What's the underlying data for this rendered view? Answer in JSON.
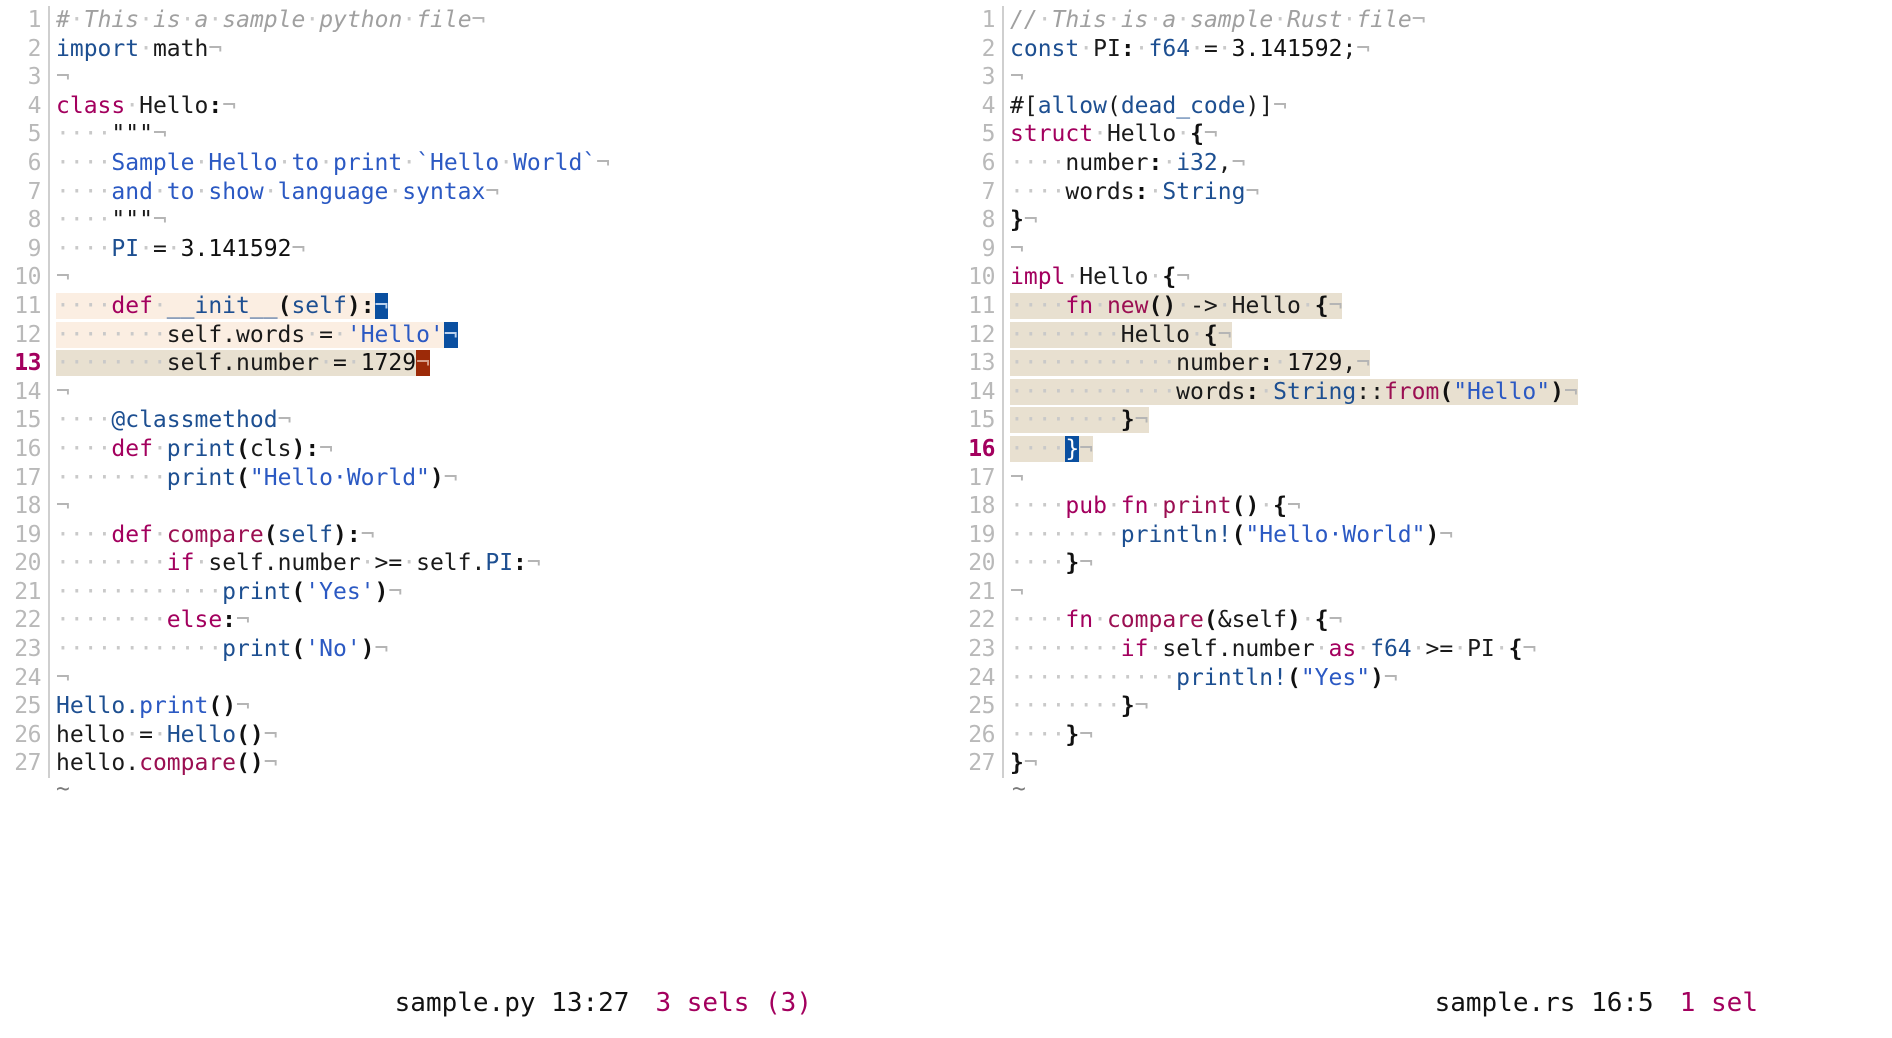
{
  "editor": {
    "kind": "terminal-text-editor",
    "colors": {
      "background": "#ffffff",
      "line_number": "#b9b9b9",
      "line_number_current": "#a3005e",
      "comment": "#a0a0a0",
      "keyword": "#a3005e",
      "function": "#9b0f52",
      "type": "#1d4f91",
      "string": "#2b59c3",
      "selection_secondary": "#fbeee2",
      "selection_primary": "#e8e0d0",
      "cursor_primary": "#0a4fa0",
      "cursor_secondary": "#9c2a08",
      "status_selection": "#a3005e"
    }
  },
  "panes": [
    {
      "id": "left-pane",
      "filename": "sample.py",
      "language": "python",
      "current_line": 13,
      "status": {
        "file_position": "sample.py 13:27",
        "selections": "3 sels (3)"
      },
      "lines": [
        {
          "n": 1,
          "text": "#·This·is·a·sample·python·file¬"
        },
        {
          "n": 2,
          "text": "import·math¬"
        },
        {
          "n": 3,
          "text": "¬"
        },
        {
          "n": 4,
          "text": "class·Hello:¬"
        },
        {
          "n": 5,
          "text": "····\"\"\"¬"
        },
        {
          "n": 6,
          "text": "····Sample·Hello·to·print·`Hello·World`¬"
        },
        {
          "n": 7,
          "text": "····and·to·show·language·syntax¬"
        },
        {
          "n": 8,
          "text": "····\"\"\"¬"
        },
        {
          "n": 9,
          "text": "····PI·=·3.141592¬"
        },
        {
          "n": 10,
          "text": "¬"
        },
        {
          "n": 11,
          "text": "····def·__init__(self):¬",
          "selected": "secondary",
          "cursor": "blue"
        },
        {
          "n": 12,
          "text": "········self.words·=·'Hello'¬",
          "selected": "secondary",
          "cursor": "blue"
        },
        {
          "n": 13,
          "text": "········self.number·=·1729¬",
          "selected": "primary",
          "cursor": "red",
          "current": true
        },
        {
          "n": 14,
          "text": "¬"
        },
        {
          "n": 15,
          "text": "····@classmethod¬"
        },
        {
          "n": 16,
          "text": "····def·print(cls):¬"
        },
        {
          "n": 17,
          "text": "········print(\"Hello·World\")¬"
        },
        {
          "n": 18,
          "text": "¬"
        },
        {
          "n": 19,
          "text": "····def·compare(self):¬"
        },
        {
          "n": 20,
          "text": "········if·self.number·>=·self.PI:¬"
        },
        {
          "n": 21,
          "text": "············print('Yes')¬"
        },
        {
          "n": 22,
          "text": "········else:¬"
        },
        {
          "n": 23,
          "text": "············print('No')¬"
        },
        {
          "n": 24,
          "text": "¬"
        },
        {
          "n": 25,
          "text": "Hello.print()¬"
        },
        {
          "n": 26,
          "text": "hello·=·Hello()¬"
        },
        {
          "n": 27,
          "text": "hello.compare()¬"
        }
      ],
      "eof_marker": "~"
    },
    {
      "id": "right-pane",
      "filename": "sample.rs",
      "language": "rust",
      "current_line": 16,
      "status": {
        "file_position": "sample.rs 16:5",
        "selections": "1 sel"
      },
      "lines": [
        {
          "n": 1,
          "text": "//·This·is·a·sample·Rust·file¬"
        },
        {
          "n": 2,
          "text": "const·PI:·f64·=·3.141592;¬"
        },
        {
          "n": 3,
          "text": "¬"
        },
        {
          "n": 4,
          "text": "#[allow(dead_code)]¬"
        },
        {
          "n": 5,
          "text": "struct·Hello·{¬"
        },
        {
          "n": 6,
          "text": "····number:·i32,¬"
        },
        {
          "n": 7,
          "text": "····words:·String¬"
        },
        {
          "n": 8,
          "text": "}¬"
        },
        {
          "n": 9,
          "text": "¬"
        },
        {
          "n": 10,
          "text": "impl·Hello·{¬"
        },
        {
          "n": 11,
          "text": "····fn·new()·->·Hello·{¬",
          "selected": "primary"
        },
        {
          "n": 12,
          "text": "········Hello·{¬",
          "selected": "primary"
        },
        {
          "n": 13,
          "text": "············number:·1729,¬",
          "selected": "primary"
        },
        {
          "n": 14,
          "text": "············words:·String::from(\"Hello\")¬",
          "selected": "primary"
        },
        {
          "n": 15,
          "text": "········}¬",
          "selected": "primary"
        },
        {
          "n": 16,
          "text": "····}¬",
          "selected": "primary",
          "cursor": "blue",
          "current": true
        },
        {
          "n": 17,
          "text": "¬"
        },
        {
          "n": 18,
          "text": "····pub·fn·print()·{¬"
        },
        {
          "n": 19,
          "text": "········println!(\"Hello·World\")¬"
        },
        {
          "n": 20,
          "text": "····}¬"
        },
        {
          "n": 21,
          "text": "¬"
        },
        {
          "n": 22,
          "text": "····fn·compare(&self)·{¬"
        },
        {
          "n": 23,
          "text": "········if·self.number·as·f64·>=·PI·{¬"
        },
        {
          "n": 24,
          "text": "············println!(\"Yes\")¬"
        },
        {
          "n": 25,
          "text": "········}¬"
        },
        {
          "n": 26,
          "text": "····}¬"
        },
        {
          "n": 27,
          "text": "}¬"
        }
      ],
      "eof_marker": "~"
    }
  ]
}
